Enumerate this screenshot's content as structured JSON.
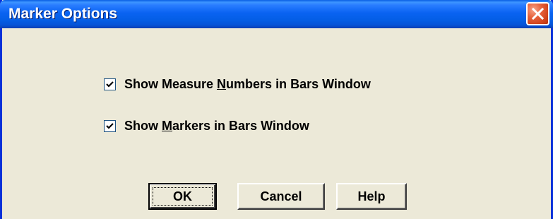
{
  "window": {
    "title": "Marker Options"
  },
  "options": [
    {
      "label_before": "Show Measure ",
      "mnemonic": "N",
      "label_after": "umbers in Bars Window",
      "checked": true
    },
    {
      "label_before": "Show ",
      "mnemonic": "M",
      "label_after": "arkers in Bars Window",
      "checked": true
    }
  ],
  "buttons": {
    "ok": "OK",
    "cancel": "Cancel",
    "help": "Help"
  },
  "icons": {
    "close": "close-icon",
    "check": "checkmark-icon"
  },
  "colors": {
    "titlebar": "#0a63f2",
    "close_button": "#e6603a",
    "dialog_background": "#ece9d8"
  }
}
